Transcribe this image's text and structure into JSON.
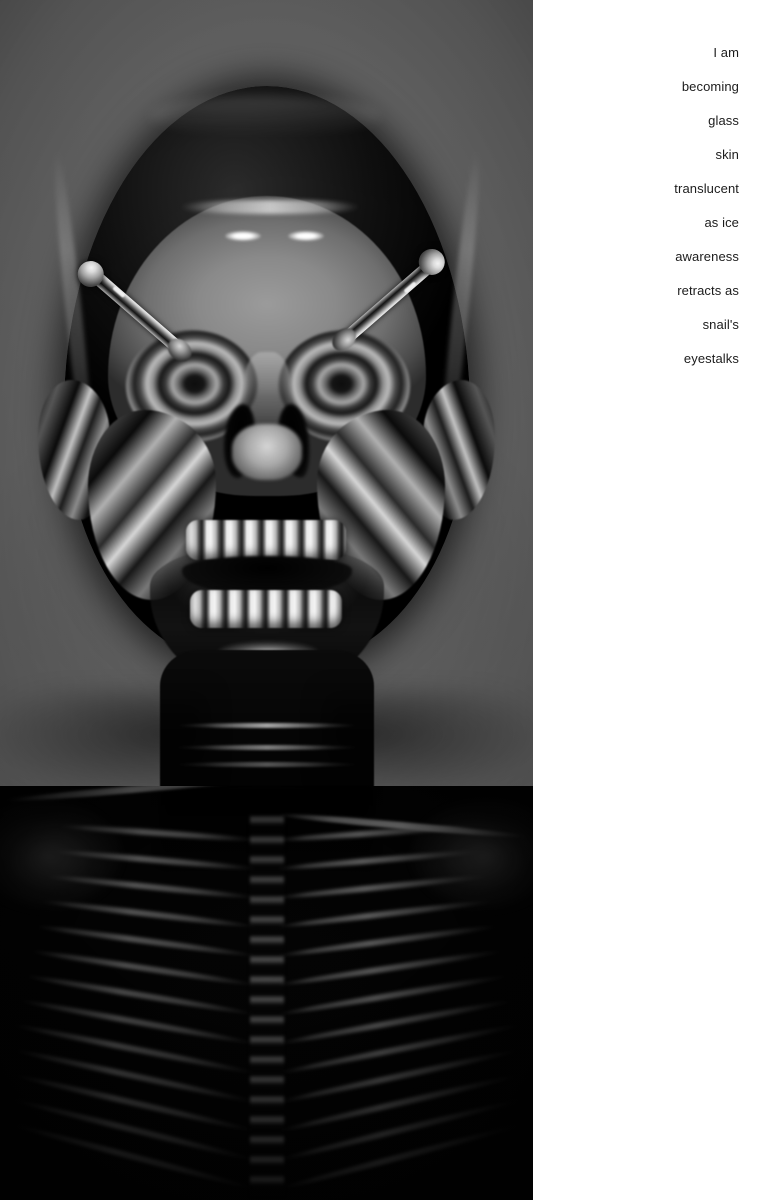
{
  "artwork": {
    "subject": "chrome-glass-skull-with-snail-eyestalks",
    "description": "Monochrome rendered glass/chrome human skull facing forward on a grey studio background, with two metallic eyestalks protruding from the eye sockets, above a dark x-ray style ribcage torso",
    "background_color": "#676767",
    "torso_color": "#040404",
    "parts": {
      "cranium": "cranium",
      "forehead": "forehead-plate",
      "eye_socket_left": "eye-socket-left",
      "eye_socket_right": "eye-socket-right",
      "eyestalk_left": "eyestalk-left",
      "eyestalk_right": "eyestalk-right",
      "ear_left": "ear-left",
      "ear_right": "ear-right",
      "nose": "nasal-aperture",
      "teeth_upper": "upper-teeth",
      "teeth_lower": "lower-teeth",
      "mandible": "mandible",
      "neck": "neck",
      "ribcage": "ribcage",
      "spine": "spine"
    }
  },
  "poem": {
    "alignment": "right",
    "text_color": "#1c1c1c",
    "background_color": "#ffffff",
    "lines": [
      "I am",
      "becoming",
      "glass",
      "skin",
      "translucent",
      "as ice",
      "awareness",
      "retracts as",
      "snail's",
      "eyestalks"
    ]
  }
}
